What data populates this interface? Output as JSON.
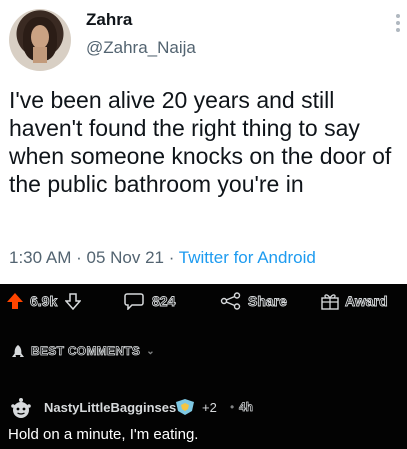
{
  "tweet": {
    "display_name": "Zahra",
    "handle": "@Zahra_Naija",
    "text": "I've been alive 20 years and still haven't found the right thing to say when someone knocks on the door of the public bathroom you're in",
    "time": "1:30 AM",
    "separator1": " · ",
    "date": "05 Nov 21",
    "separator2": " · ",
    "source": "Twitter for Android"
  },
  "post_actions": {
    "upvote_count": "6.9k",
    "comment_count": "824",
    "share_label": "Share",
    "award_label": "Award"
  },
  "sort": {
    "label": "BEST COMMENTS",
    "chevron": "⌄"
  },
  "comment": {
    "username": "NastyLittleBagginses",
    "award_count": "+2",
    "dot": "•",
    "age": "4h",
    "body": "Hold on a minute, I'm eating."
  },
  "colors": {
    "upvote": "#ff4500",
    "link": "#1d9bf0",
    "dark_bg": "#030303"
  }
}
